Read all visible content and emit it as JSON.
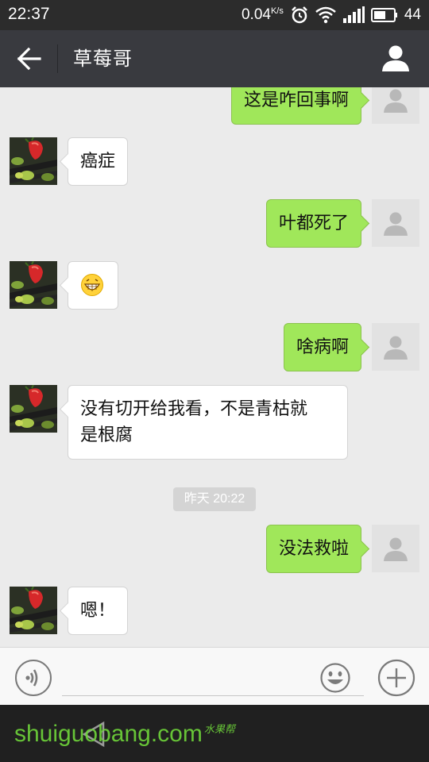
{
  "status_bar": {
    "time": "22:37",
    "network_speed": "0.04",
    "network_speed_unit": "K/s",
    "battery_level": "44"
  },
  "header": {
    "title": "草莓哥"
  },
  "messages": [
    {
      "direction": "out",
      "text": "这是咋回事啊"
    },
    {
      "direction": "in",
      "text": "癌症"
    },
    {
      "direction": "out",
      "text": "叶都死了"
    },
    {
      "direction": "in",
      "text": "😁",
      "icon": "grin-emoji-icon"
    },
    {
      "direction": "out",
      "text": "啥病啊"
    },
    {
      "direction": "in",
      "text_line1": "没有切开给我看，不是青枯就",
      "text_line2": "是根腐"
    },
    {
      "direction": "out",
      "text": "没法救啦"
    },
    {
      "direction": "in",
      "text": "嗯！"
    }
  ],
  "timestamp": "昨天 20:22",
  "input_bar": {
    "placeholder": ""
  },
  "watermark": {
    "text": "shuiguobang.com",
    "text_cn": "水果帮"
  },
  "colors": {
    "header_bg": "#393a3f",
    "chat_bg": "#ebebeb",
    "outgoing_bubble": "#a0e75a",
    "incoming_bubble": "#ffffff"
  }
}
